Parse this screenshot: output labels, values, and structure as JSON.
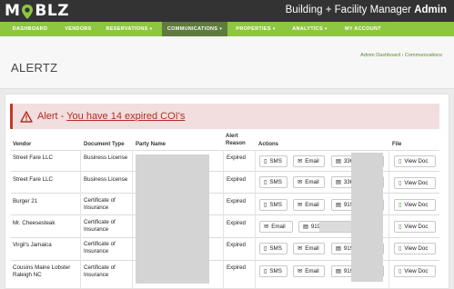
{
  "app": {
    "logo_text_left": "M",
    "logo_text_right": "BLZ",
    "brand_title": "Building + Facility Manager",
    "brand_user": "Admin"
  },
  "nav": [
    {
      "label": "DASHBOARD"
    },
    {
      "label": "VENDORS"
    },
    {
      "label": "RESERVATIONS",
      "caret": "▾"
    },
    {
      "label": "COMMUNICATIONS",
      "caret": "▾"
    },
    {
      "label": "PROPERTIES",
      "caret": "▾"
    },
    {
      "label": "ANALYTICS",
      "caret": "▾"
    },
    {
      "label": "MY ACCOUNT"
    }
  ],
  "page": {
    "title": "ALERTZ",
    "breadcrumb": [
      "Admin Dashboard",
      "Communications"
    ],
    "breadcrumb_sep": "›"
  },
  "alert": {
    "prefix": "Alert - ",
    "link": "You have 14   expired COI's"
  },
  "table": {
    "headers": {
      "vendor": "Vendor",
      "doc_type": "Document Type",
      "party": "Party Name",
      "reason": "Alert Reason",
      "actions": "Actions",
      "file": "File"
    },
    "rows": [
      {
        "vendor": "Street Fare LLC",
        "doc_type": "Business License",
        "reason": "Expired",
        "actions": [
          "SMS",
          "Email",
          "336"
        ],
        "file": "View Doc"
      },
      {
        "vendor": "Street Fare LLC",
        "doc_type": "Business License",
        "reason": "Expired",
        "actions": [
          "SMS",
          "Email",
          "336"
        ],
        "file": "View Doc"
      },
      {
        "vendor": "Burger 21",
        "doc_type": "Certificate of Insurance",
        "reason": "Expired",
        "actions": [
          "SMS",
          "Email",
          "919"
        ],
        "file": "View Doc"
      },
      {
        "vendor": "Mr. Cheesesteak",
        "doc_type": "Certificate of Insurance",
        "reason": "Expired",
        "actions": [
          "Email",
          "919"
        ],
        "file": "View Doc"
      },
      {
        "vendor": "Virgil's Jamaica",
        "doc_type": "Certificate of Insurance",
        "reason": "Expired",
        "actions": [
          "SMS",
          "Email",
          "919"
        ],
        "file": "View Doc"
      },
      {
        "vendor": "Cousins Maine Lobster Raleigh NC",
        "doc_type": "Certificate of Insurance",
        "reason": "Expired",
        "actions": [
          "SMS",
          "Email",
          "919"
        ],
        "file": "View Doc"
      }
    ]
  },
  "colors": {
    "topbar": "#333333",
    "nav": "#8dc63f",
    "nav_active": "#5f7b3d",
    "alert_bg": "#f2dede",
    "alert_text": "#b52d22"
  }
}
